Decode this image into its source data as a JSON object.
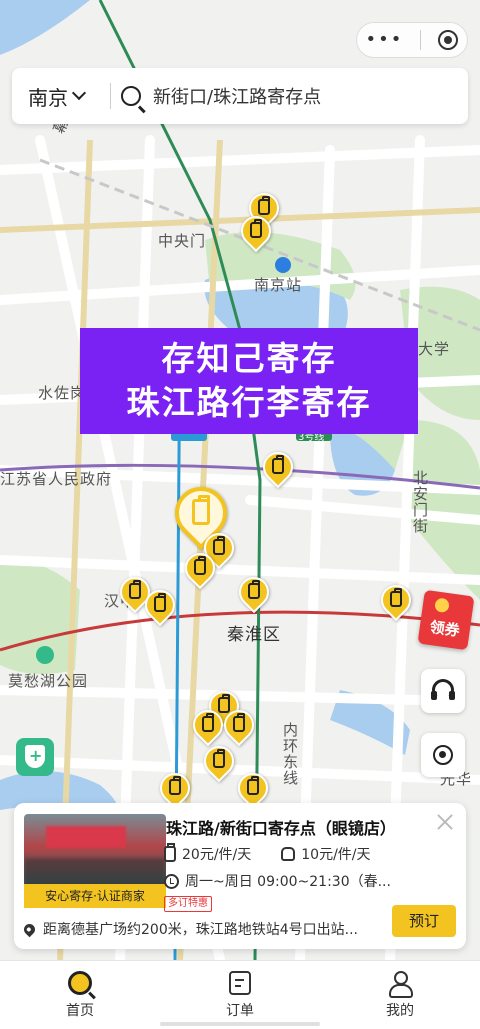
{
  "map": {
    "labels": {
      "gate": "中央门",
      "station": "南京站",
      "shuizuo": "水佐岗",
      "gov": "江苏省人民政府",
      "beian": "北安门街",
      "hanzhong": "汉中",
      "qinhuai": "秦淮区",
      "mochou": "莫愁湖公园",
      "inner_ring": "内环东线",
      "guanghua": "光华",
      "university": "大学",
      "mufu": "幕府西路"
    },
    "subway_badges": {
      "line3": "3号线"
    }
  },
  "search": {
    "city": "南京",
    "query": "新街口/珠江路寄存点"
  },
  "banner": {
    "line1": "存知己寄存",
    "line2": "珠江路行李寄存"
  },
  "coupon": {
    "label": "领券"
  },
  "store": {
    "name": "珠江路/新街口寄存点（眼镜店）",
    "certified": "安心寄存·认证商家",
    "luggage_price": "20元/件/天",
    "bag_price": "10元/件/天",
    "hours": "周一~周日 09:00~21:30（春...",
    "badge": "多订特惠",
    "address": "距离德基广场约200米，珠江路地铁站4号口出站...",
    "book_label": "预订"
  },
  "tabs": [
    {
      "label": "首页",
      "icon": "search-home-icon"
    },
    {
      "label": "订单",
      "icon": "order-icon"
    },
    {
      "label": "我的",
      "icon": "person-icon"
    }
  ],
  "colors": {
    "accent": "#f3c41f",
    "banner": "#7a22f4",
    "coupon": "#e9383a",
    "shield": "#34b98a"
  }
}
